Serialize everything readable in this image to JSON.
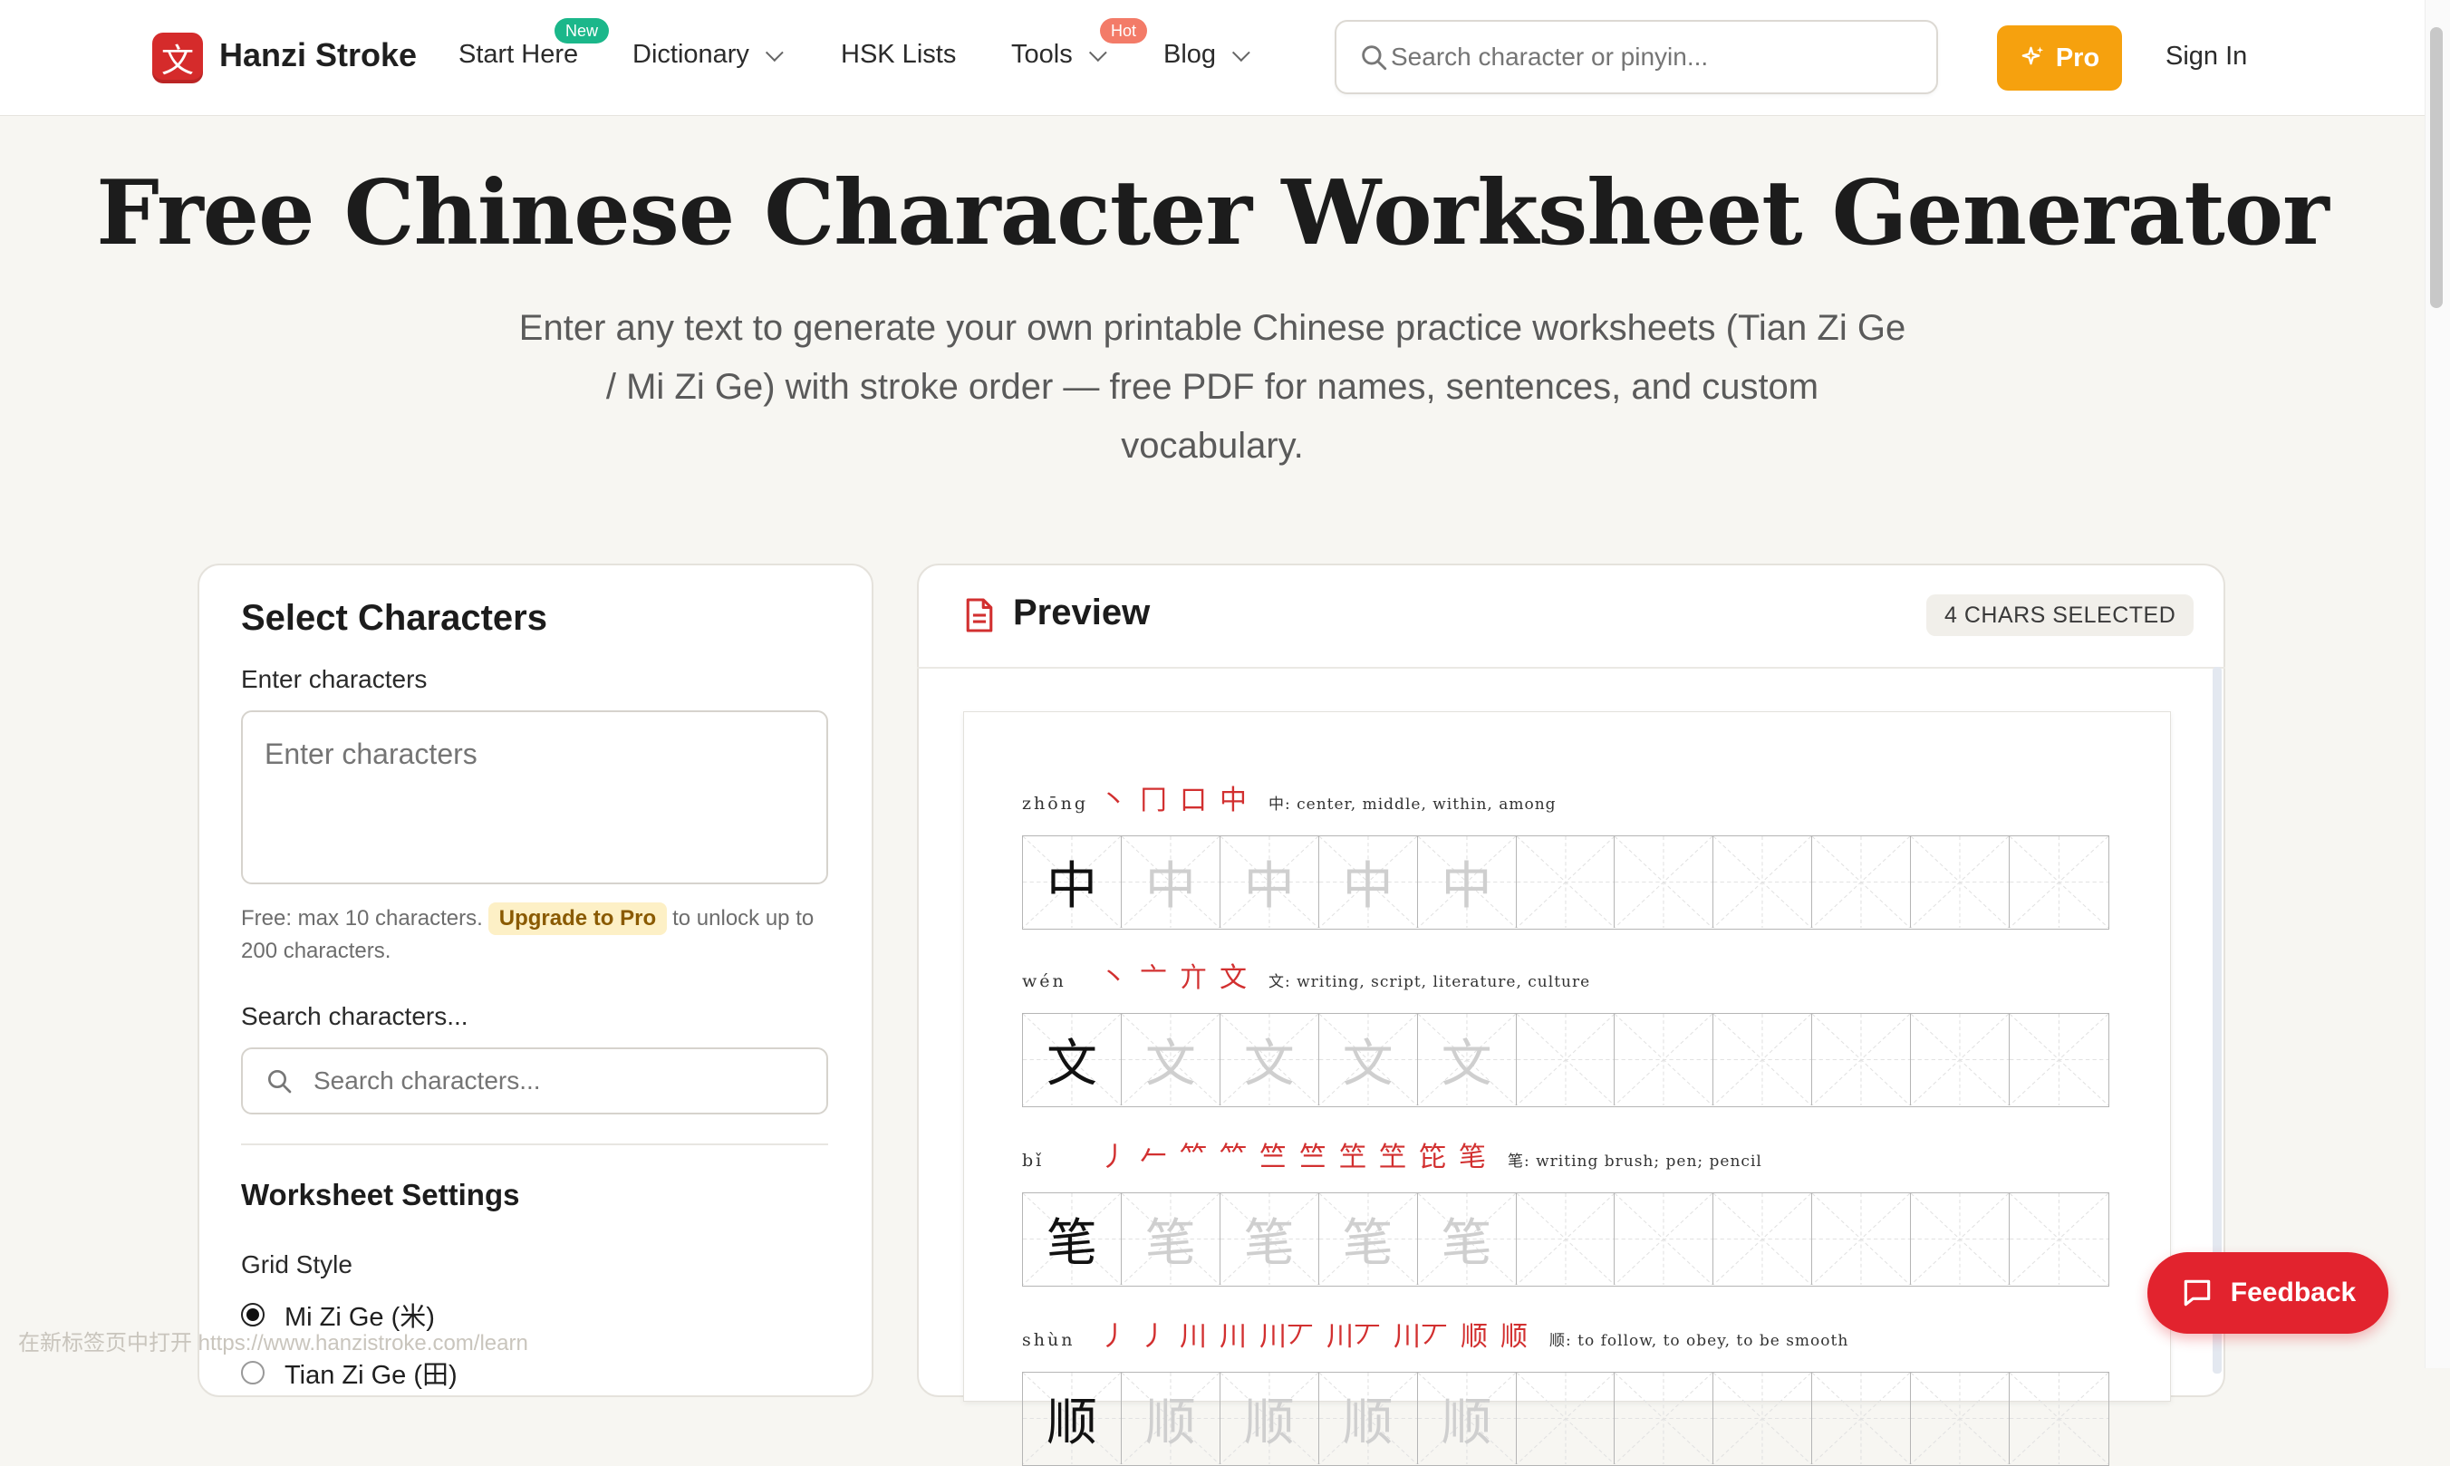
{
  "header": {
    "logo_glyph": "文",
    "brand": "Hanzi Stroke",
    "nav": [
      {
        "label": "Start Here",
        "badge": "New",
        "badge_color": "#1bb78a"
      },
      {
        "label": "Dictionary",
        "dropdown": true
      },
      {
        "label": "HSK Lists"
      },
      {
        "label": "Tools",
        "badge": "Hot",
        "badge_color": "#f37b68",
        "dropdown": true
      },
      {
        "label": "Blog",
        "dropdown": true
      }
    ],
    "search_placeholder": "Search character or pinyin...",
    "pro_label": "Pro",
    "signin_label": "Sign In",
    "pro_color": "#f6a10e"
  },
  "hero": {
    "title": "Free Chinese Character Worksheet Generator",
    "subtitle": "Enter any text to generate your own printable Chinese practice worksheets (Tian Zi Ge / Mi Zi Ge) with stroke order — free PDF for names, sentences, and custom vocabulary."
  },
  "select": {
    "title": "Select Characters",
    "enter_label": "Enter characters",
    "enter_placeholder": "Enter characters",
    "help_before": "Free: max 10 characters.",
    "upgrade_label": "Upgrade to Pro",
    "help_after": "to unlock up to 200 characters.",
    "search_label": "Search characters...",
    "search_placeholder": "Search characters...",
    "settings_title": "Worksheet Settings",
    "grid_style_label": "Grid Style",
    "grid_options": [
      {
        "label": "Mi Zi Ge (米)",
        "selected": true
      },
      {
        "label": "Tian Zi Ge (田)",
        "selected": false
      }
    ]
  },
  "status_bar_url": "在新标签页中打开 https://www.hanzistroke.com/learn",
  "preview": {
    "title": "Preview",
    "chip": "4 CHARS SELECTED",
    "accent": "#d23030",
    "rows": [
      {
        "char": "中",
        "pinyin": "zhōng",
        "strokes": [
          "丶",
          "冂",
          "口",
          "中"
        ],
        "definition": "中: center, middle, within, among"
      },
      {
        "char": "文",
        "pinyin": "wén",
        "strokes": [
          "丶",
          "亠",
          "亣",
          "文"
        ],
        "definition": "文: writing, script, literature, culture"
      },
      {
        "char": "笔",
        "pinyin": "bǐ",
        "strokes": [
          "丿",
          "𠂉",
          "⺮",
          "⺮",
          "竺",
          "竺",
          "笁",
          "笁",
          "笓",
          "笔"
        ],
        "definition": "笔: writing brush; pen; pencil"
      },
      {
        "char": "顺",
        "pinyin": "shùn",
        "strokes": [
          "丿",
          "丿",
          "川",
          "川",
          "川丆",
          "川丆",
          "川丆",
          "顺",
          "顺"
        ],
        "definition": "顺: to follow, to obey, to be smooth"
      }
    ],
    "cells_per_row": 11,
    "trace_count": 4
  },
  "feedback_label": "Feedback"
}
